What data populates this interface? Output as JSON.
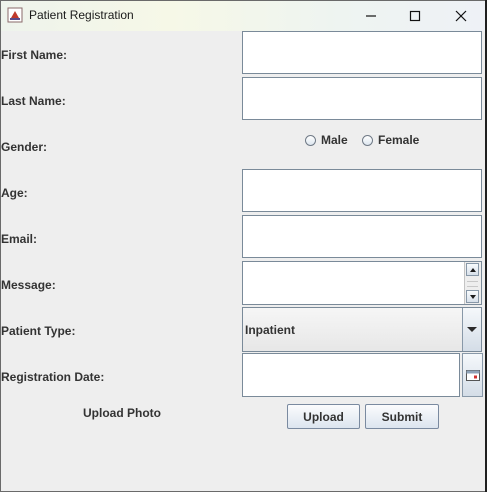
{
  "window": {
    "title": "Patient Registration",
    "controls": {
      "minimize": "minimize-icon",
      "maximize": "maximize-icon",
      "close": "close-icon"
    }
  },
  "form": {
    "first_name": {
      "label": "First Name:",
      "value": ""
    },
    "last_name": {
      "label": "Last Name:",
      "value": ""
    },
    "gender": {
      "label": "Gender:",
      "options": [
        "Male",
        "Female"
      ],
      "selected": null
    },
    "age": {
      "label": "Age:",
      "value": ""
    },
    "email": {
      "label": "Email:",
      "value": ""
    },
    "message": {
      "label": "Message:",
      "value": ""
    },
    "patient_type": {
      "label": "Patient Type:",
      "selected": "Inpatient"
    },
    "registration_date": {
      "label": "Registration Date:",
      "value": ""
    },
    "upload_photo": {
      "label": "Upload Photo"
    }
  },
  "buttons": {
    "upload": "Upload",
    "submit": "Submit"
  },
  "colors": {
    "field_border": "#7a8a99",
    "background": "#eeeeee",
    "label_text": "#333333"
  }
}
